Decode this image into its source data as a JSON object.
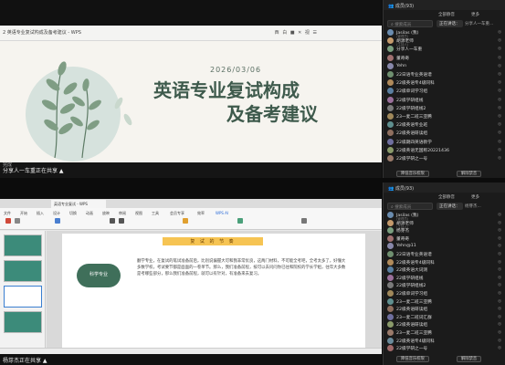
{
  "top_share": {
    "slide_file_title": "2 英语专业复试构成及备考建议 - WPS",
    "slide_controls": "西 白 ■ ✕ 视 ☰",
    "slide": {
      "date": "2026/03/06",
      "title_line1": "英语专业复试构成",
      "title_line2": "及备考建议"
    },
    "mini_label": "完成",
    "share_label": "分享人一车重正在共享 ▲"
  },
  "bottom_share": {
    "tab_label": "英语专业复试 - WPS",
    "ribbon": [
      "文件",
      "开始",
      "插入",
      "设计",
      "切换",
      "动画",
      "放映",
      "审阅",
      "视图",
      "工具",
      "会员专享",
      "效率",
      "WPS AI"
    ],
    "page": {
      "heading": "复 试 的 节 奏",
      "circle_label": "科学专业",
      "body": "翻学专业，在复试的笔试准备前后，比别说偏握大可和我非常优良，这两门材料，不可能全考吧，全考太多了，好懂大多数学校，考试要节都是面面的一卷单节。那么，我们准备前程，按可以去问问你已往和院校的学长学姐，往年大多数是考哪些部分，那么我们准备前程，就可以有针对，有准备来去复习。"
    },
    "share_label": "杨芽杰正在共享 ▲"
  },
  "panel_top": {
    "header": "成员(93)",
    "tools": [
      "全部静音",
      "更多"
    ],
    "search_placeholder": "搜索成员",
    "tab_active": "正在讲话：",
    "tab_other": "分享人一车重...",
    "members": [
      {
        "name": "Jasilas (我)",
        "sub": "(管理员)",
        "status": "◎",
        "color": "#6a8caf"
      },
      {
        "name": "胡源老师",
        "sub": "(主持人)",
        "status": "◎",
        "color": "#c49a6c"
      },
      {
        "name": "分享人一车重",
        "sub": "",
        "status": "◎",
        "color": "#7a9e7e"
      },
      {
        "name": "董奇奇",
        "sub": "",
        "status": "◎",
        "color": "#a07070"
      },
      {
        "name": "Yehn",
        "sub": "",
        "status": "◎",
        "color": "#8888aa"
      },
      {
        "name": "22日语专业英语谱",
        "sub": "",
        "status": "◎",
        "color": "#6f8f6f"
      },
      {
        "name": "22级英语专4级同科",
        "sub": "",
        "status": "◎",
        "color": "#b08a5a"
      },
      {
        "name": "22级单词学习组",
        "sub": "",
        "status": "◎",
        "color": "#5a7fa0"
      },
      {
        "name": "22级学研组线",
        "sub": "",
        "status": "◎",
        "color": "#9a6f9a"
      },
      {
        "name": "22级学研组线2",
        "sub": "",
        "status": "◎",
        "color": "#7a7a7a"
      },
      {
        "name": "23一麦二班三亚腾",
        "sub": "",
        "status": "◎",
        "color": "#a0885a"
      },
      {
        "name": "22级英语专业班",
        "sub": "",
        "status": "◎",
        "color": "#5f8f8f"
      },
      {
        "name": "22级英语研读组",
        "sub": "",
        "status": "◎",
        "color": "#8f6f5f"
      },
      {
        "name": "22级期四英语教学",
        "sub": "",
        "status": "◎",
        "color": "#6f6f9f"
      },
      {
        "name": "22级英语无国称20221436",
        "sub": "",
        "status": "◎",
        "color": "#8a9a6a"
      },
      {
        "name": "22级学研之一号",
        "sub": "",
        "status": "◎",
        "color": "#9a7a6a"
      }
    ],
    "footer_buttons": [
      "降低音乐权限",
      "解除禁音"
    ]
  },
  "panel_bottom": {
    "header": "成员(93)",
    "tools": [
      "全部静音",
      "更多"
    ],
    "search_placeholder": "搜索成员",
    "tab_active": "正在讲话：",
    "tab_other": "杨芽杰...",
    "members": [
      {
        "name": "Jasilas (我)",
        "sub": "(管理员)",
        "status": "◎",
        "color": "#6a8caf"
      },
      {
        "name": "胡源老师",
        "sub": "(主持人)",
        "status": "◎",
        "color": "#c49a6c"
      },
      {
        "name": "杨芽杰",
        "sub": "",
        "status": "◎",
        "color": "#7a9e7e"
      },
      {
        "name": "董奇奇",
        "sub": "",
        "status": "◎",
        "color": "#a07070"
      },
      {
        "name": "Yehn@11",
        "sub": "",
        "status": "◎",
        "color": "#8888aa"
      },
      {
        "name": "22日语专业英语谱",
        "sub": "",
        "status": "◎",
        "color": "#6f8f6f"
      },
      {
        "name": "22级英语专4级同科",
        "sub": "",
        "status": "◎",
        "color": "#b08a5a"
      },
      {
        "name": "22级英语大词测",
        "sub": "",
        "status": "◎",
        "color": "#5a7fa0"
      },
      {
        "name": "22级学研组线",
        "sub": "",
        "status": "◎",
        "color": "#9a6f9a"
      },
      {
        "name": "22级学研组线2",
        "sub": "",
        "status": "◎",
        "color": "#7a7a7a"
      },
      {
        "name": "22级单词学习组",
        "sub": "",
        "status": "◎",
        "color": "#a0885a"
      },
      {
        "name": "23一麦二班三亚腾",
        "sub": "",
        "status": "◎",
        "color": "#5f8f8f"
      },
      {
        "name": "22级英语研读组",
        "sub": "",
        "status": "◎",
        "color": "#8f6f5f"
      },
      {
        "name": "23一麦二班词汇群",
        "sub": "",
        "status": "◎",
        "color": "#6f6f9f"
      },
      {
        "name": "22级英语研读组",
        "sub": "",
        "status": "◎",
        "color": "#8a9a6a"
      },
      {
        "name": "23一麦二班三亚腾",
        "sub": "",
        "status": "◎",
        "color": "#9a7a6a"
      },
      {
        "name": "22级英语专4级同科",
        "sub": "",
        "status": "◎",
        "color": "#6a8a9a"
      },
      {
        "name": "22级学研之一号",
        "sub": "",
        "status": "◎",
        "color": "#a06a6a"
      }
    ],
    "footer_buttons": [
      "降低音乐权限",
      "解除禁音"
    ]
  }
}
